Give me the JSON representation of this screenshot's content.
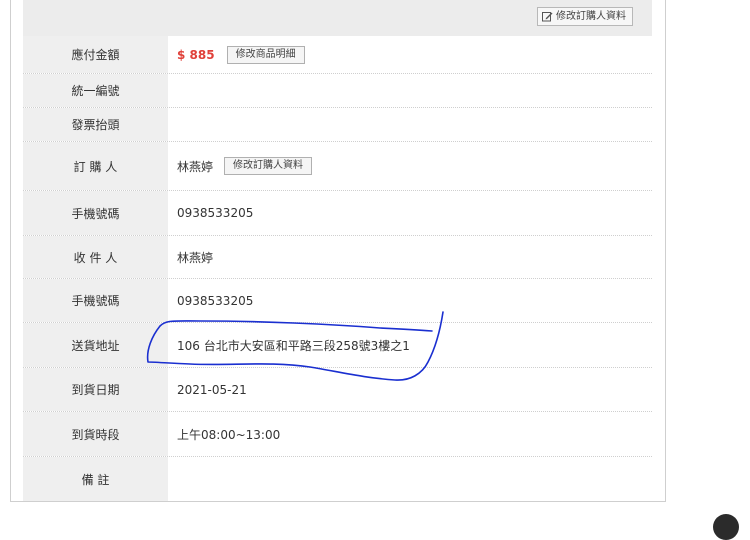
{
  "toolbar": {
    "edit_orderer_label": "修改訂購人資料"
  },
  "rows": [
    {
      "label": "應付金額",
      "price": "$ 885",
      "button": "修改商品明細"
    },
    {
      "label": "統一編號",
      "value": ""
    },
    {
      "label": "發票抬頭",
      "value": ""
    },
    {
      "label": "訂 購 人",
      "value": "林燕婷",
      "button": "修改訂購人資料"
    },
    {
      "label": "手機號碼",
      "value": "0938533205"
    },
    {
      "label": "收 件 人",
      "value": "林燕婷"
    },
    {
      "label": "手機號碼",
      "value": "0938533205"
    },
    {
      "label": "送貨地址",
      "value": "106 台北市大安區和平路三段258號3樓之1"
    },
    {
      "label": "到貨日期",
      "value": "2021-05-21"
    },
    {
      "label": "到貨時段",
      "value": "上午08:00~13:00"
    },
    {
      "label": "備 註",
      "value": ""
    }
  ],
  "colors": {
    "price": "#e0413a",
    "label_bg": "#efefef",
    "annotation_ink": "#1a2fd0"
  },
  "icons": {
    "edit": "edit-icon"
  }
}
